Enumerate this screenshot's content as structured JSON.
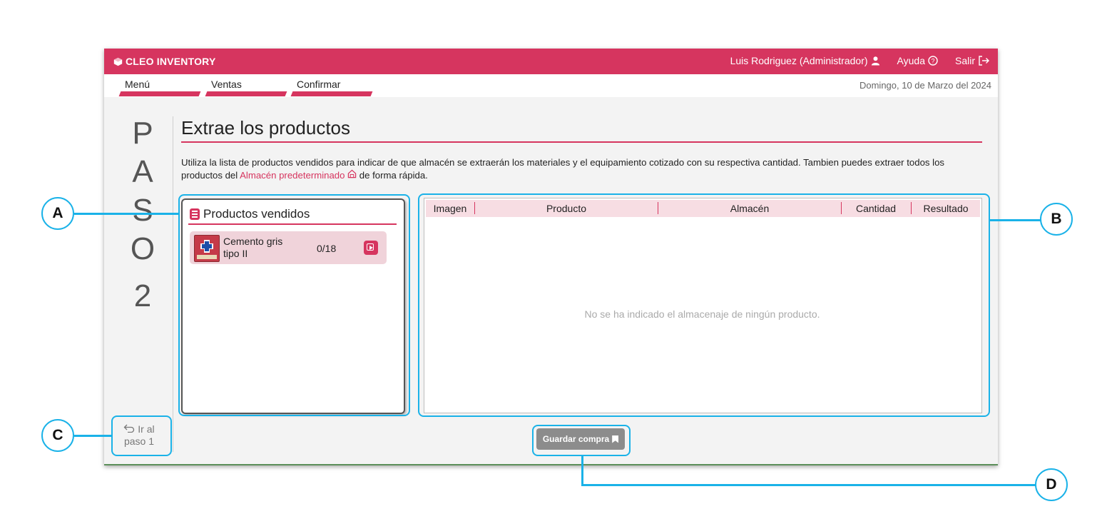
{
  "app": {
    "brand": "CLEO INVENTORY",
    "user_label": "Luis Rodriguez (Administrador)",
    "help_label": "Ayuda",
    "logout_label": "Salir",
    "date": "Domingo, 10 de Marzo del 2024"
  },
  "nav": {
    "tabs": [
      {
        "label": "Menú"
      },
      {
        "label": "Ventas"
      },
      {
        "label": "Confirmar"
      }
    ]
  },
  "step": {
    "letters": [
      "P",
      "A",
      "S",
      "O",
      "2"
    ],
    "title": "Extrae los productos",
    "desc_part1": "Utiliza la lista de productos vendidos para indicar de que almacén se extraerán los materiales y el equipamiento cotizado con su respectiva cantidad. Tambien puedes extraer todos los productos del ",
    "desc_link": "Almacén predeterminado",
    "desc_part2": " de forma rápida."
  },
  "sold_products": {
    "title": "Productos vendidos",
    "items": [
      {
        "name": "Cemento gris tipo II",
        "qty": "0/18"
      }
    ]
  },
  "storage_table": {
    "columns": [
      "Imagen",
      "Producto",
      "Almacén",
      "Cantidad",
      "Resultado"
    ],
    "empty_message": "No se ha indicado el almacenaje de ningún producto."
  },
  "back_button": {
    "line1": "Ir al",
    "line2": "paso 1"
  },
  "save_button": {
    "label": "Guardar compra"
  },
  "callouts": {
    "a": "A",
    "b": "B",
    "c": "C",
    "d": "D"
  },
  "colors": {
    "brand": "#d6355f",
    "highlight": "#1ab2e8",
    "save_button": "#8c8c8c"
  }
}
